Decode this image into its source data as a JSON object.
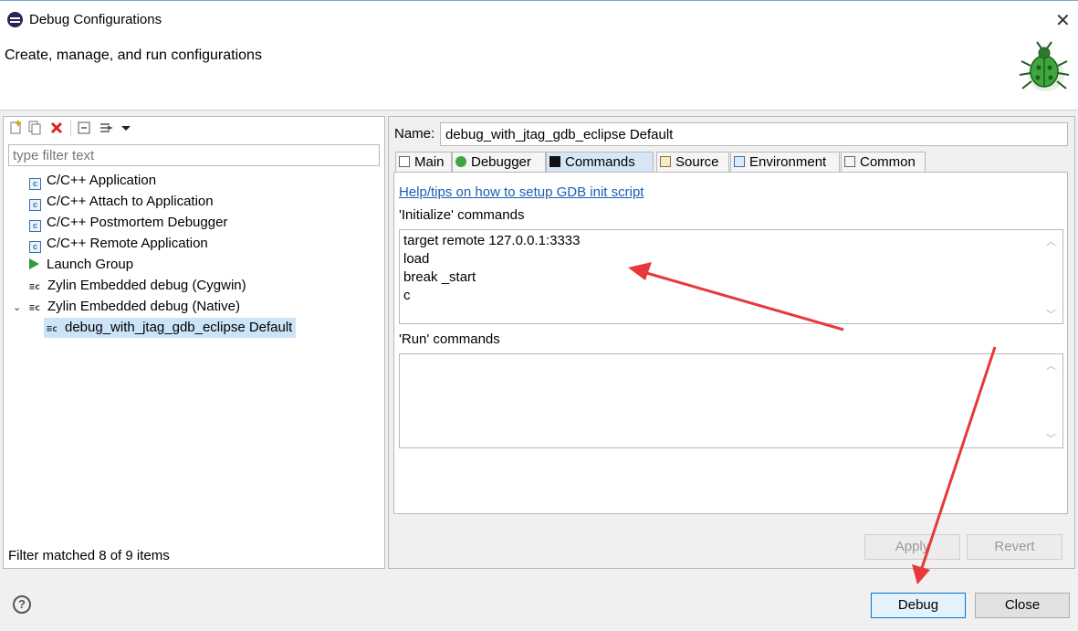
{
  "window": {
    "title": "Debug Configurations",
    "close_glyph": "✕"
  },
  "header": {
    "subtitle": "Create, manage, and run configurations",
    "icon": "bug-icon"
  },
  "left": {
    "filter_placeholder": "type filter text",
    "items": [
      "C/C++ Application",
      "C/C++ Attach to Application",
      "C/C++ Postmortem Debugger",
      "C/C++ Remote Application",
      "Launch Group",
      "Zylin Embedded debug (Cygwin)",
      "Zylin Embedded debug (Native)",
      "debug_with_jtag_gdb_eclipse Default"
    ],
    "status": "Filter matched 8 of 9 items"
  },
  "right": {
    "name_label": "Name:",
    "name_value": "debug_with_jtag_gdb_eclipse Default",
    "tabs": [
      "Main",
      "Debugger",
      "Commands",
      "Source",
      "Environment",
      "Common"
    ],
    "active_tab": "Commands",
    "help_link": "Help/tips on how to setup GDB init script",
    "init_label": "'Initialize' commands",
    "init_lines": [
      "target remote 127.0.0.1:3333",
      "load",
      "break _start",
      "c"
    ],
    "run_label": "'Run' commands",
    "apply": "Apply",
    "revert": "Revert"
  },
  "footer": {
    "help": "?",
    "debug": "Debug",
    "close": "Close"
  },
  "colors": {
    "annotation_arrow": "#e8383b",
    "link": "#1a5fb4",
    "selection": "#cce4f7"
  }
}
